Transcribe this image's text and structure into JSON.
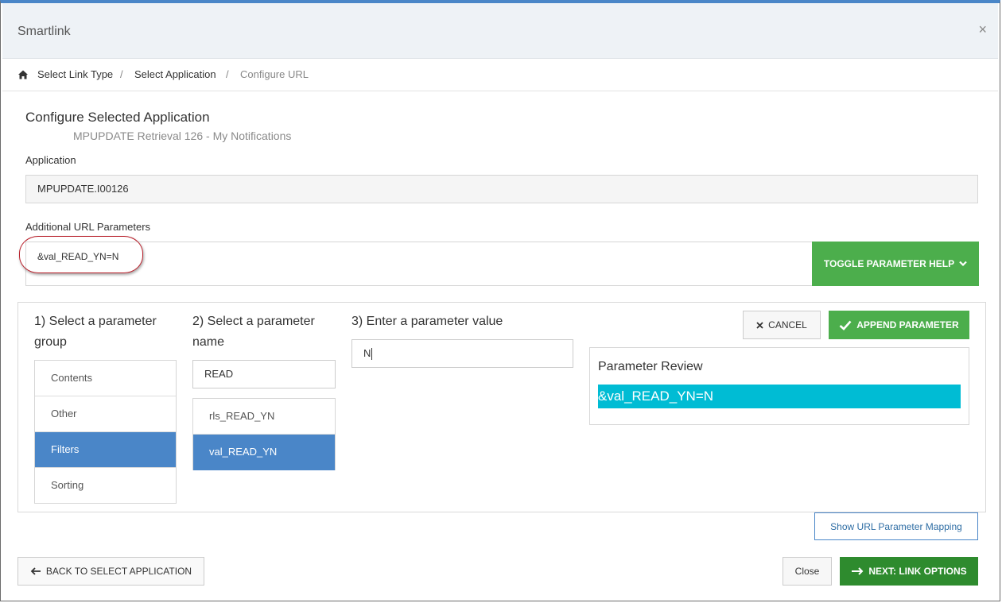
{
  "modal": {
    "title": "Smartlink",
    "close_glyph": "×"
  },
  "breadcrumb": {
    "home_icon": "home-icon",
    "items": [
      {
        "label": "Select Link Type"
      },
      {
        "label": "Select Application"
      },
      {
        "label": "Configure URL"
      }
    ],
    "separator": "/"
  },
  "section": {
    "title": "Configure Selected Application",
    "subtitle": "MPUPDATE Retrieval 126 - My Notifications"
  },
  "application": {
    "label": "Application",
    "value": "MPUPDATE.I00126"
  },
  "url_params": {
    "label": "Additional URL Parameters",
    "value": "&val_READ_YN=N",
    "toggle_label": "TOGGLE PARAMETER HELP",
    "highlight_color": "#b81f2a"
  },
  "parameter_help": {
    "step1_label": "1) Select a parameter group",
    "groups": [
      {
        "label": "Contents"
      },
      {
        "label": "Other"
      },
      {
        "label": "Filters"
      },
      {
        "label": "Sorting"
      }
    ],
    "step2_label": "2) Select a parameter name",
    "name_filter": "READ",
    "names": [
      {
        "label": "rls_READ_YN"
      },
      {
        "label": "val_READ_YN"
      }
    ],
    "step3_label": "3) Enter a parameter value",
    "value_input": "N",
    "cancel_label": "CANCEL",
    "append_label": "APPEND PARAMETER",
    "review_title": "Parameter Review",
    "review_value": "&val_READ_YN=N",
    "review_color": "#00bcd4"
  },
  "mapping_button": "Show URL Parameter Mapping",
  "footer": {
    "back_label": "BACK TO SELECT APPLICATION",
    "close_label": "Close",
    "next_label": "NEXT: LINK OPTIONS"
  },
  "colors": {
    "success": "#4cae4c",
    "success_dark": "#2e8b2e",
    "primary": "#4a86c8"
  }
}
